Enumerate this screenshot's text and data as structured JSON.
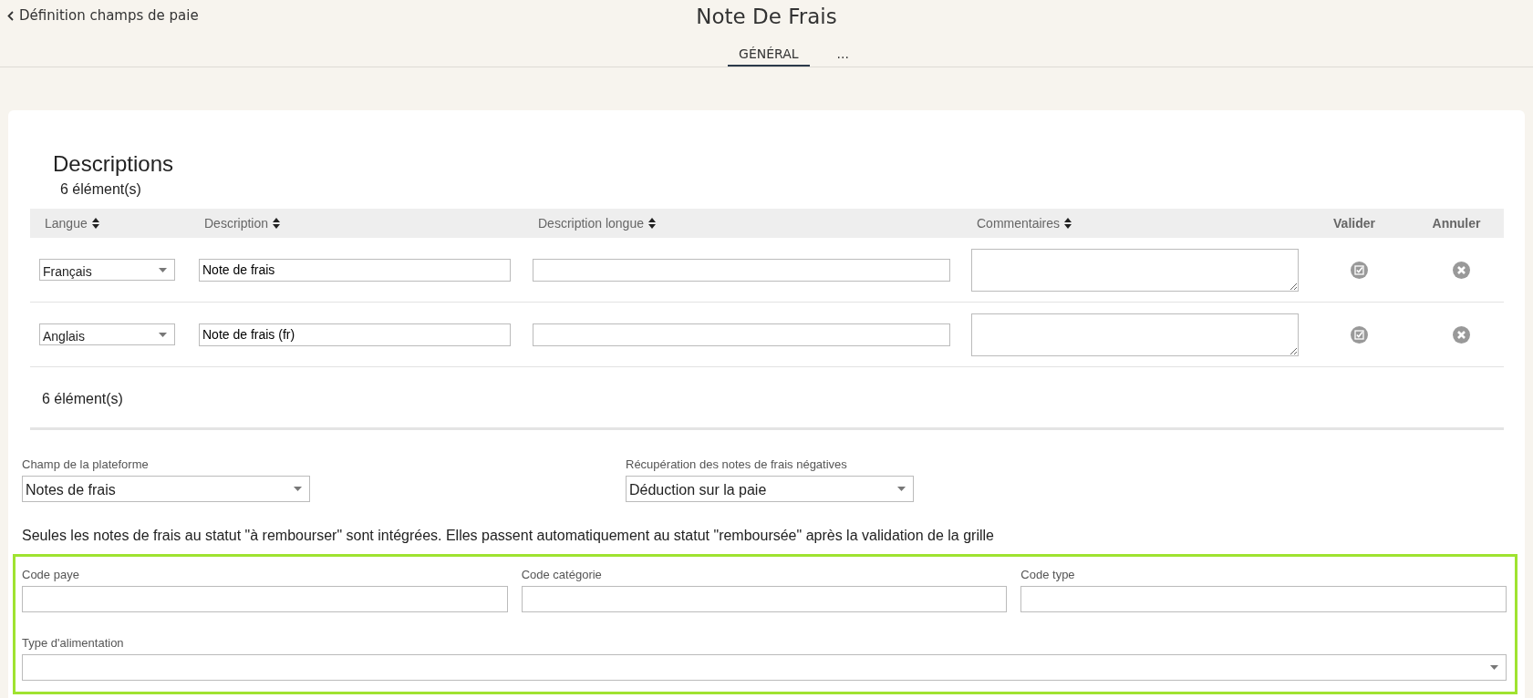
{
  "header": {
    "back_link": "Définition champs de paie",
    "title": "Note De Frais"
  },
  "tabs": [
    {
      "label": "GÉNÉRAL",
      "selected": true
    },
    {
      "label": "...",
      "selected": false
    }
  ],
  "descriptions": {
    "title": "Descriptions",
    "count_top": "6 élément(s)",
    "columns": [
      {
        "label": "Langue",
        "sortable": true
      },
      {
        "label": "Description",
        "sortable": true
      },
      {
        "label": "Description longue",
        "sortable": true
      },
      {
        "label": "Commentaires",
        "sortable": true
      },
      {
        "label": "Valider",
        "sortable": false
      },
      {
        "label": "Annuler",
        "sortable": false
      }
    ],
    "rows": [
      {
        "language": "Français",
        "description": "Note de frais",
        "long_description": "",
        "comments": ""
      },
      {
        "language": "Anglais",
        "description": "Note de frais (fr)",
        "long_description": "",
        "comments": ""
      }
    ],
    "count_bottom": "6 élément(s)"
  },
  "platform_field": {
    "label": "Champ de la plateforme",
    "value": "Notes de frais"
  },
  "negative_recovery": {
    "label": "Récupération des notes de frais négatives",
    "value": "Déduction sur la paie"
  },
  "note": "Seules les notes de frais au statut \"à rembourser\" sont intégrées. Elles passent automatiquement au statut \"remboursée\" après la validation de la grille",
  "codes": [
    {
      "label": "Code paye",
      "kind": "text"
    },
    {
      "label": "Code catégorie",
      "kind": "text"
    },
    {
      "label": "Code type",
      "kind": "text"
    },
    {
      "label": "Type d'alimentation",
      "kind": "select"
    }
  ]
}
